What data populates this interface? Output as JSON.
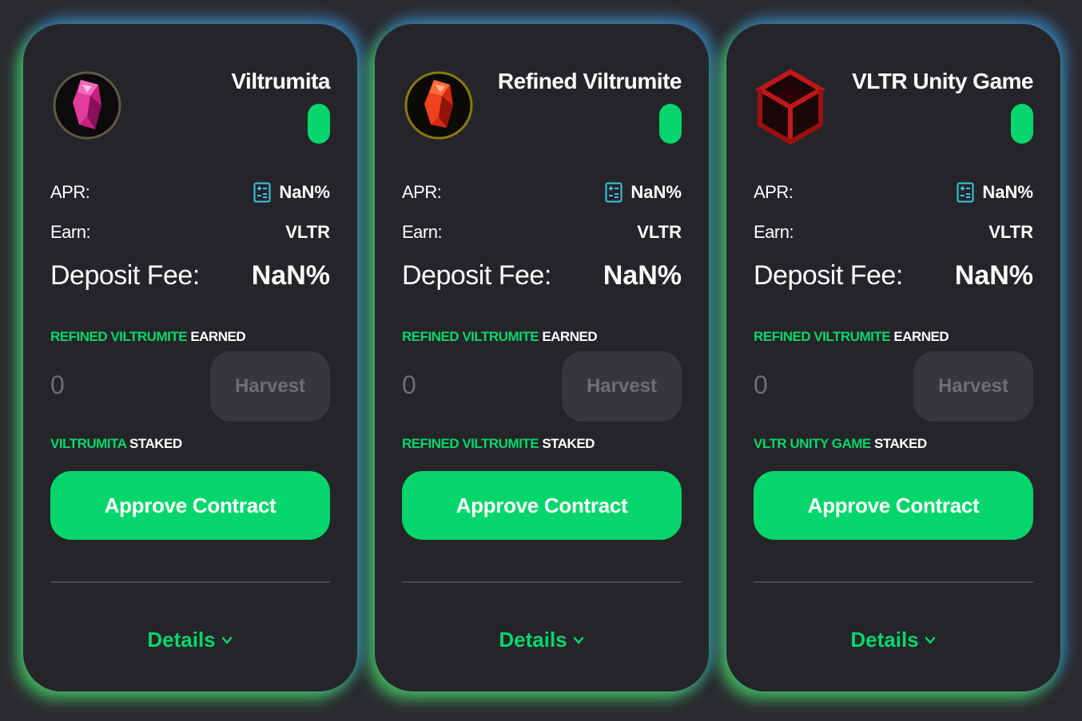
{
  "cards": [
    {
      "title": "Viltrumita",
      "logo": "pink-crystal-icon",
      "apr_label": "APR:",
      "apr_value": "NaN%",
      "earn_label": "Earn:",
      "earn_value": "VLTR",
      "fee_label": "Deposit Fee:",
      "fee_value": "NaN%",
      "earned_token": "REFINED VILTRUMITE",
      "earned_word": "EARNED",
      "earned_amount": "0",
      "harvest_label": "Harvest",
      "staked_token": "VILTRUMITA",
      "staked_word": "STAKED",
      "approve_label": "Approve Contract",
      "details_label": "Details"
    },
    {
      "title": "Refined Viltrumite",
      "logo": "red-crystal-icon",
      "apr_label": "APR:",
      "apr_value": "NaN%",
      "earn_label": "Earn:",
      "earn_value": "VLTR",
      "fee_label": "Deposit Fee:",
      "fee_value": "NaN%",
      "earned_token": "REFINED VILTRUMITE",
      "earned_word": "EARNED",
      "earned_amount": "0",
      "harvest_label": "Harvest",
      "staked_token": "REFINED VILTRUMITE",
      "staked_word": "STAKED",
      "approve_label": "Approve Contract",
      "details_label": "Details"
    },
    {
      "title": "VLTR Unity Game",
      "logo": "unity-cube-icon",
      "apr_label": "APR:",
      "apr_value": "NaN%",
      "earn_label": "Earn:",
      "earn_value": "VLTR",
      "fee_label": "Deposit Fee:",
      "fee_value": "NaN%",
      "earned_token": "REFINED VILTRUMITE",
      "earned_word": "EARNED",
      "earned_amount": "0",
      "harvest_label": "Harvest",
      "staked_token": "VLTR UNITY GAME",
      "staked_word": "STAKED",
      "approve_label": "Approve Contract",
      "details_label": "Details"
    }
  ],
  "colors": {
    "background": "#2b2b2f",
    "card": "#252529",
    "accent_green": "#05d66b",
    "harvest_bg": "#37363c",
    "muted_text": "#6c6c72"
  }
}
